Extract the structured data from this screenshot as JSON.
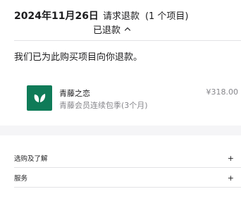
{
  "header": {
    "date": "2024年11月26日",
    "title": "请求退款",
    "count": "(1 个项目)"
  },
  "status": {
    "label": "已退款",
    "icon": "chevron-up-icon"
  },
  "message": "我们已为此购买项目向你退款。",
  "item": {
    "logo_icon": "leaf-logo-icon",
    "logo_color": "#0f7b58",
    "name": "青藤之恋",
    "subtitle": "青藤会员连续包季(3个月)",
    "price": "¥318.00"
  },
  "sections": [
    {
      "label": "选购及了解",
      "icon": "plus-icon",
      "symbol": "+"
    },
    {
      "label": "服务",
      "icon": "plus-icon",
      "symbol": "+"
    }
  ],
  "colors": {
    "text": "#1d1d1f",
    "secondary": "#86868b",
    "divider": "#e3e3e6",
    "band": "#f5f5f7"
  }
}
